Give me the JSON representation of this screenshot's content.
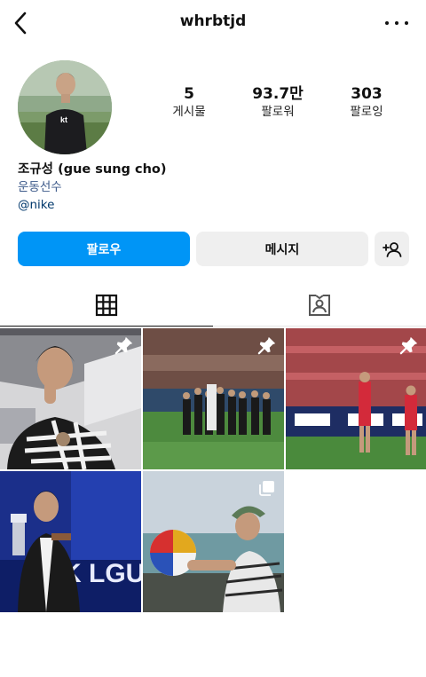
{
  "header": {
    "username": "whrbtjd",
    "back_icon": "chevron-left-icon",
    "more_icon": "more-dots-icon"
  },
  "profile": {
    "avatar_icon": "profile-avatar",
    "stats": [
      {
        "value": "5",
        "label": "게시물"
      },
      {
        "value": "93.7만",
        "label": "팔로워"
      },
      {
        "value": "303",
        "label": "팔로잉"
      }
    ],
    "name": "조규성 (gue sung cho)",
    "category": "운동선수",
    "mention": "@nike"
  },
  "actions": {
    "follow_label": "팔로우",
    "message_label": "메시지",
    "add_person_icon": "add-person-icon"
  },
  "tabs": [
    {
      "icon": "grid-icon",
      "active": true
    },
    {
      "icon": "tagged-icon",
      "active": false
    }
  ],
  "posts": [
    {
      "pinned": true,
      "multi": false
    },
    {
      "pinned": true,
      "multi": false
    },
    {
      "pinned": true,
      "multi": false
    },
    {
      "pinned": false,
      "multi": false
    },
    {
      "pinned": false,
      "multi": true
    }
  ],
  "colors": {
    "accent": "#0095f6",
    "link": "#00376b",
    "secondary_button": "#efefef"
  }
}
